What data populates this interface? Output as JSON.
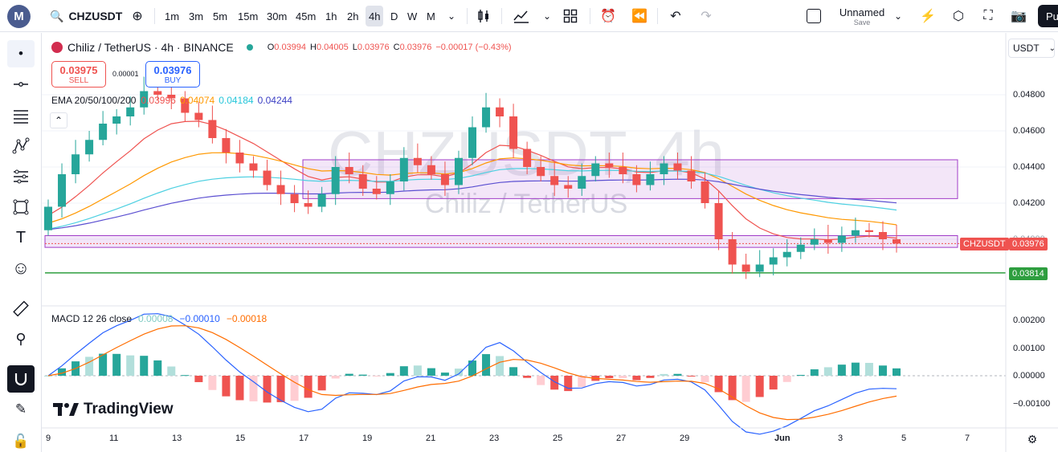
{
  "topbar": {
    "logo_letter": "M",
    "symbol": "CHZUSDT",
    "intervals": [
      "1m",
      "3m",
      "5m",
      "15m",
      "30m",
      "45m",
      "1h",
      "2h",
      "4h",
      "D",
      "W",
      "M"
    ],
    "active_interval": "4h",
    "layout_name": "Unnamed",
    "layout_status": "Save",
    "publish_label": "Pu"
  },
  "legend": {
    "title": "Chiliz / TetherUS · 4h · BINANCE",
    "open_label": "O",
    "open": "0.03994",
    "high_label": "H",
    "high": "0.04005",
    "low_label": "L",
    "low": "0.03976",
    "close_label": "C",
    "close": "0.03976",
    "change": "−0.00017 (−0.43%)",
    "sell_price": "0.03975",
    "sell_label": "SELL",
    "spread": "0.00001",
    "buy_price": "0.03976",
    "buy_label": "BUY",
    "ema_label": "EMA 20/50/100/200",
    "ema_values": [
      "0.03996",
      "0.04074",
      "0.04184",
      "0.04244"
    ],
    "macd_label": "MACD 12 26 close",
    "macd_values": [
      "0.00008",
      "−0.00010",
      "−0.00018"
    ],
    "collapse_icon": "chevron-up-icon"
  },
  "watermark": {
    "symbol": "CHZUSDT, 4h",
    "name": "Chiliz / TetherUS"
  },
  "brand": "TradingView",
  "axis": {
    "currency": "USDT",
    "price_ticks": [
      "0.04800",
      "0.04600",
      "0.04400",
      "0.04200",
      "0.04000"
    ],
    "macd_ticks": [
      "0.00200",
      "0.00100",
      "0.00000",
      "−0.00100"
    ],
    "symbol_tag": "CHZUSDT",
    "last_price": "0.03976",
    "line_price": "0.03814",
    "time_ticks": [
      "9",
      "11",
      "13",
      "15",
      "17",
      "19",
      "21",
      "23",
      "25",
      "27",
      "29",
      "Jun",
      "3",
      "5",
      "7"
    ]
  },
  "colors": {
    "up": "#26a69a",
    "down": "#ef5350",
    "ema20": "#ef5350",
    "ema50": "#ff9800",
    "ema100": "#4dd0e1",
    "ema200": "#5b4fd1",
    "zone": "#a03cc8",
    "hline": "#2e9e3f",
    "macd": "#2962ff",
    "signal": "#ff6d00"
  },
  "chart_data": {
    "type": "candlestick",
    "series_name": "CHZUSDT 4h",
    "price_range": [
      0.0372,
      0.049
    ],
    "candles_close_approx": [
      0.0418,
      0.0436,
      0.0447,
      0.0455,
      0.0464,
      0.0468,
      0.0473,
      0.0482,
      0.048,
      0.0478,
      0.047,
      0.0466,
      0.0456,
      0.0448,
      0.0442,
      0.0438,
      0.043,
      0.0425,
      0.042,
      0.0418,
      0.0425,
      0.044,
      0.0436,
      0.0428,
      0.0425,
      0.0432,
      0.0445,
      0.0441,
      0.0436,
      0.043,
      0.0445,
      0.0462,
      0.0473,
      0.0468,
      0.045,
      0.044,
      0.0435,
      0.043,
      0.0428,
      0.0435,
      0.0442,
      0.044,
      0.0436,
      0.043,
      0.0436,
      0.0442,
      0.0438,
      0.0432,
      0.042,
      0.04,
      0.0386,
      0.0382,
      0.0386,
      0.039,
      0.0393,
      0.0397,
      0.04,
      0.0398,
      0.0402,
      0.0405,
      0.0404,
      0.04,
      0.03976
    ],
    "horizontal_line": 0.03814,
    "zones": [
      {
        "from": 0.04225,
        "to": 0.0444
      },
      {
        "from": 0.03955,
        "to": 0.0402
      }
    ],
    "macd_range": [
      -0.0015,
      0.0024
    ]
  }
}
